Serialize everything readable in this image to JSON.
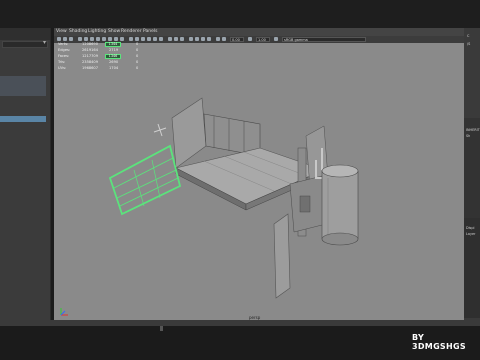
{
  "viewport": {
    "menu": [
      "View",
      "Shading",
      "Lighting",
      "Show",
      "Renderer",
      "Panels"
    ],
    "toolbar": {
      "field_a": "0.00",
      "field_b": "1.00",
      "colorspace": "sRGB gamma"
    },
    "camera": "persp"
  },
  "hud": {
    "rows": [
      {
        "label": "Verts:",
        "total": "1208690",
        "sel": "1344",
        "extra": "0"
      },
      {
        "label": "Edges:",
        "total": "2619164",
        "sel": "2719",
        "extra": "0"
      },
      {
        "label": "Faces:",
        "total": "1217709",
        "sel": "1346",
        "extra": "0"
      },
      {
        "label": "Tris:",
        "total": "2358409",
        "sel": "2690",
        "extra": "0"
      },
      {
        "label": "UVs:",
        "total": "1968607",
        "sel": "1704",
        "extra": "0"
      }
    ]
  },
  "channel_box": {
    "text_1": "C",
    "text_2": "/S",
    "text_3": "INHERIT",
    "text_4": "Sh",
    "text_5": "Dispi",
    "text_6": "Layer"
  },
  "watermark": "BY 3DMGSHGS",
  "colors": {
    "selection_green": "#5be37c",
    "viewport_bg": "#8a8a8a",
    "panel_bg": "#3b3b3b"
  }
}
